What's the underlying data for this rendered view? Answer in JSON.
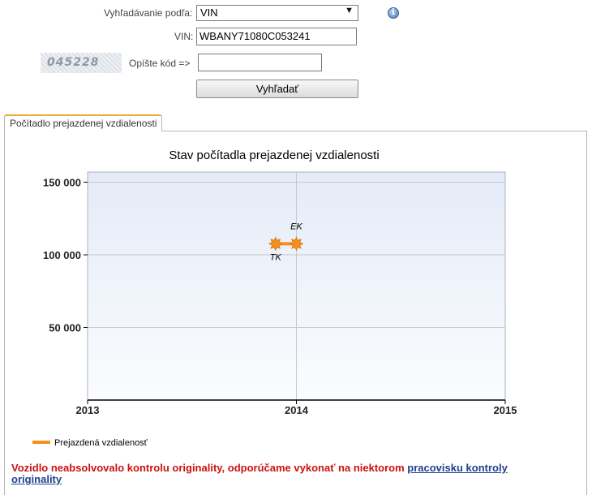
{
  "form": {
    "search_by_label": "Vyhľadávanie podľa:",
    "search_by_value": "VIN",
    "vin_label": "VIN:",
    "vin_value": "WBANY71080C053241",
    "captcha_text": "045228",
    "captcha_label": "Opíšte kód =>",
    "captcha_value": "",
    "search_button": "Vyhľadať"
  },
  "tab": {
    "label": "Počítadlo prejazdenej vzdialenosti"
  },
  "chart_data": {
    "type": "line",
    "title": "Stav počítadla prejazdenej vzdialenosti",
    "x_ticks": [
      "2013",
      "2014",
      "2015"
    ],
    "y_ticks": [
      "150 000",
      "100 000",
      "50 000"
    ],
    "xlim": [
      2013,
      2015
    ],
    "ylim": [
      0,
      157000
    ],
    "grid": true,
    "series": [
      {
        "name": "Prejazdená vzdialenosť",
        "color": "#f5901e",
        "points": [
          {
            "x": 2013.9,
            "y": 107600,
            "label": "TK"
          },
          {
            "x": 2014.0,
            "y": 107600,
            "label": "EK"
          }
        ]
      }
    ],
    "legend_position": "bottom-left"
  },
  "warning": {
    "text": "Vozidlo neabsolvovalo kontrolu originality, odporúčame vykonať na niektorom ",
    "link": "pracovisku kontroly originality"
  }
}
